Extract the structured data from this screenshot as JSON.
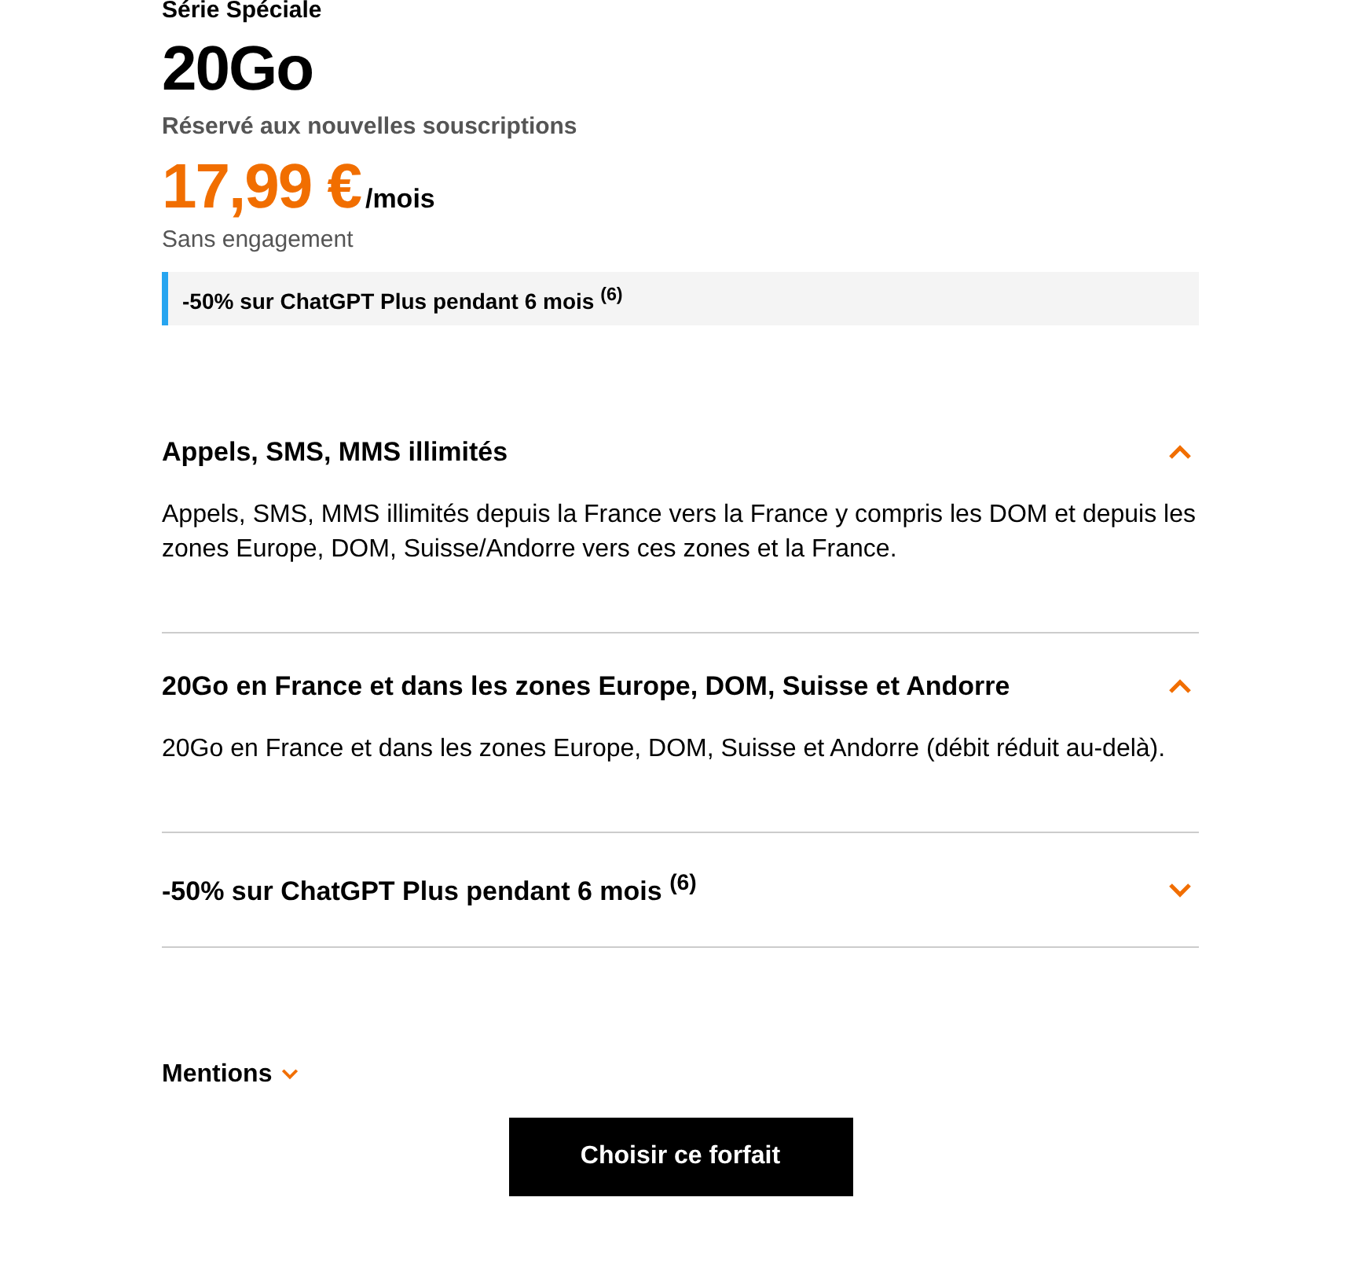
{
  "header": {
    "eyebrow": "Série Spéciale",
    "title": "20Go",
    "subtitle": "Réservé aux nouvelles souscriptions",
    "price": "17,99 €",
    "period": "/mois",
    "commitment": "Sans engagement"
  },
  "promo_banner": "-50% sur ChatGPT Plus pendant 6 mois $^{(6)}$",
  "sections": [
    {
      "title": "Appels, SMS, MMS illimités",
      "expanded": true,
      "body": "Appels, SMS, MMS illimités depuis la France vers la France y compris les DOM et depuis les zones Europe, DOM, Suisse/Andorre vers ces zones et la France."
    },
    {
      "title": "20Go en France et dans les zones Europe, DOM, Suisse et Andorre",
      "expanded": true,
      "body": "20Go en France et dans les zones Europe, DOM, Suisse et Andorre (débit réduit au-delà)."
    },
    {
      "title": "-50% sur ChatGPT Plus pendant 6 mois $^{(6)}$",
      "expanded": false
    }
  ],
  "mentions": {
    "label": "Mentions",
    "expanded": false
  },
  "cta_button": "Choisir ce forfait"
}
